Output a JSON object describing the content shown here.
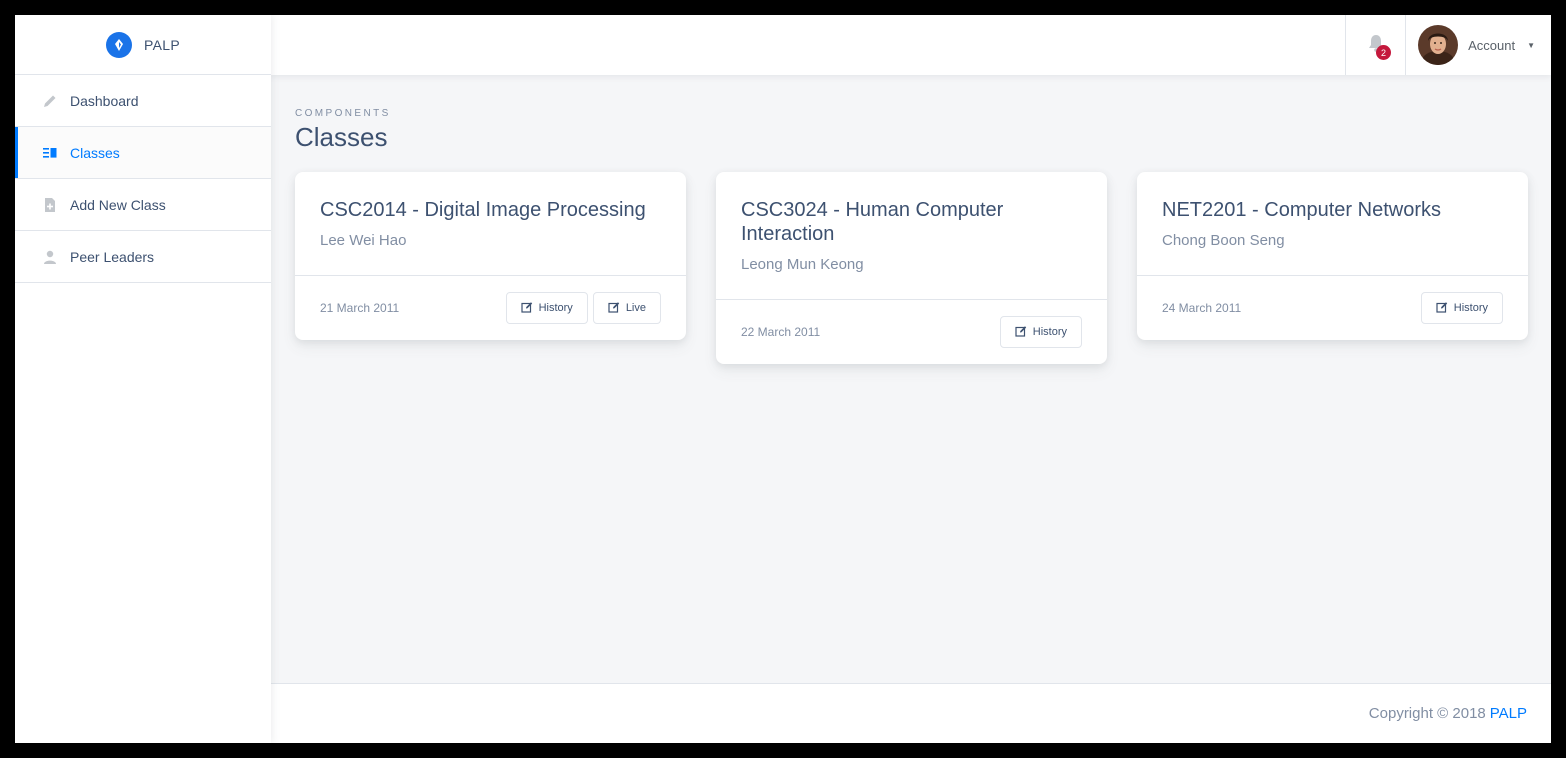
{
  "brand": {
    "name": "PALP"
  },
  "sidebar": {
    "items": [
      {
        "label": "Dashboard",
        "icon": "pencil-icon"
      },
      {
        "label": "Classes",
        "icon": "list-icon",
        "active": true
      },
      {
        "label": "Add New Class",
        "icon": "file-add-icon"
      },
      {
        "label": "Peer Leaders",
        "icon": "person-icon"
      }
    ]
  },
  "topbar": {
    "notifications_count": "2",
    "account_label": "Account"
  },
  "page": {
    "subtitle": "Components",
    "title": "Classes"
  },
  "classes": [
    {
      "title": "CSC2014 - Digital Image Processing",
      "lecturer": "Lee Wei Hao",
      "date": "21 March 2011",
      "buttons": [
        "History",
        "Live"
      ]
    },
    {
      "title": "CSC3024 - Human Computer Interaction",
      "lecturer": "Leong Mun Keong",
      "date": "22 March 2011",
      "buttons": [
        "History"
      ]
    },
    {
      "title": "NET2201 - Computer Networks",
      "lecturer": "Chong Boon Seng",
      "date": "24 March 2011",
      "buttons": [
        "History"
      ]
    }
  ],
  "footer": {
    "copyright": "Copyright © 2018",
    "link": "PALP"
  },
  "colors": {
    "accent": "#007bff",
    "badge": "#c4183c",
    "text": "#3d5170",
    "muted": "#818ea3"
  }
}
